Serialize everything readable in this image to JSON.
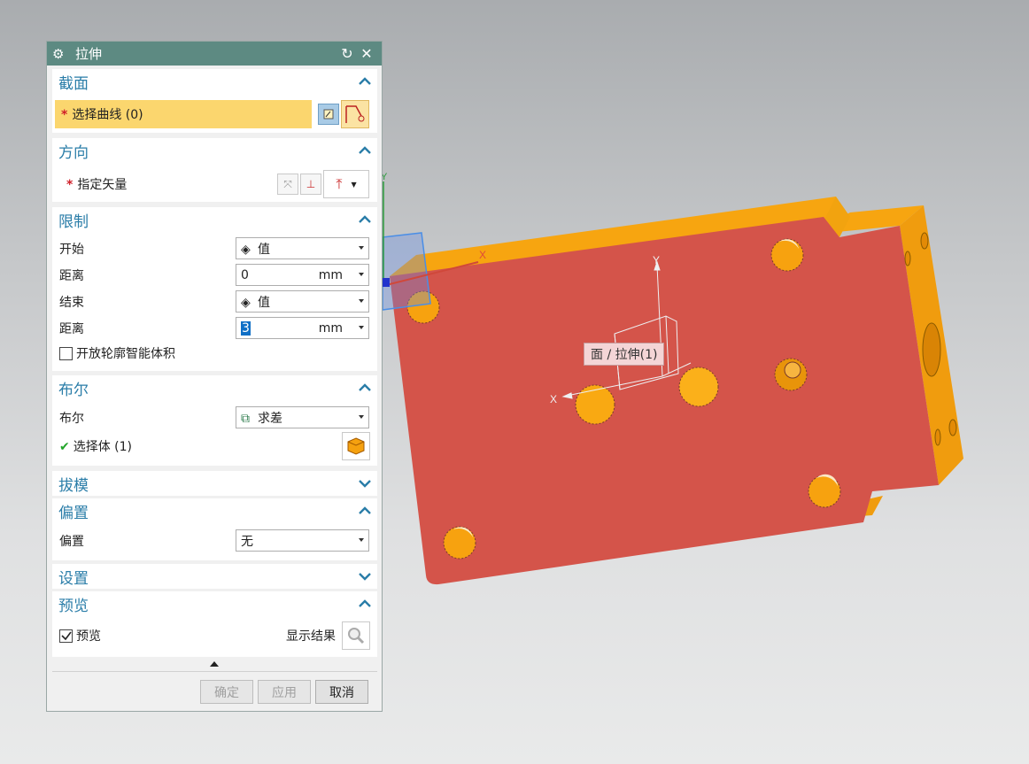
{
  "dialog": {
    "title": "拉伸",
    "title_icon": "gear-icon",
    "reset_icon": "reset-icon",
    "close_icon": "close-icon"
  },
  "sections": {
    "section": {
      "title": "截面",
      "select_curve_label": "选择曲线 (0)",
      "required_mark": "*"
    },
    "direction": {
      "title": "方向",
      "specify_vector_label": "指定矢量",
      "required_mark": "*"
    },
    "limits": {
      "title": "限制",
      "start_label": "开始",
      "start_value": "值",
      "start_distance_label": "距离",
      "start_distance_value": "0",
      "start_unit": "mm",
      "end_label": "结束",
      "end_value": "值",
      "end_distance_label": "距离",
      "end_distance_value": "3",
      "end_unit": "mm",
      "open_profile_label": "开放轮廓智能体积"
    },
    "boolean": {
      "title": "布尔",
      "boolean_label": "布尔",
      "boolean_value": "求差",
      "select_body_label": "选择体 (1)",
      "check_mark": "✔"
    },
    "draft": {
      "title": "拔模"
    },
    "offset": {
      "title": "偏置",
      "offset_label": "偏置",
      "offset_value": "无"
    },
    "settings": {
      "title": "设置"
    },
    "preview": {
      "title": "预览",
      "preview_label": "预览",
      "show_result_label": "显示结果"
    }
  },
  "footer": {
    "ok": "确定",
    "apply": "应用",
    "cancel": "取消"
  },
  "viewport": {
    "tooltip": "面 / 拉伸(1)",
    "axis_x": "X",
    "axis_y": "Y",
    "wcs_x": "X",
    "wcs_y": "Y"
  },
  "colors": {
    "title_bar": "#5d8a82",
    "section_title": "#2a7da8",
    "highlight_row": "#fbd66e",
    "face_red": "#d4544a",
    "body_orange": "#f5a10f"
  }
}
